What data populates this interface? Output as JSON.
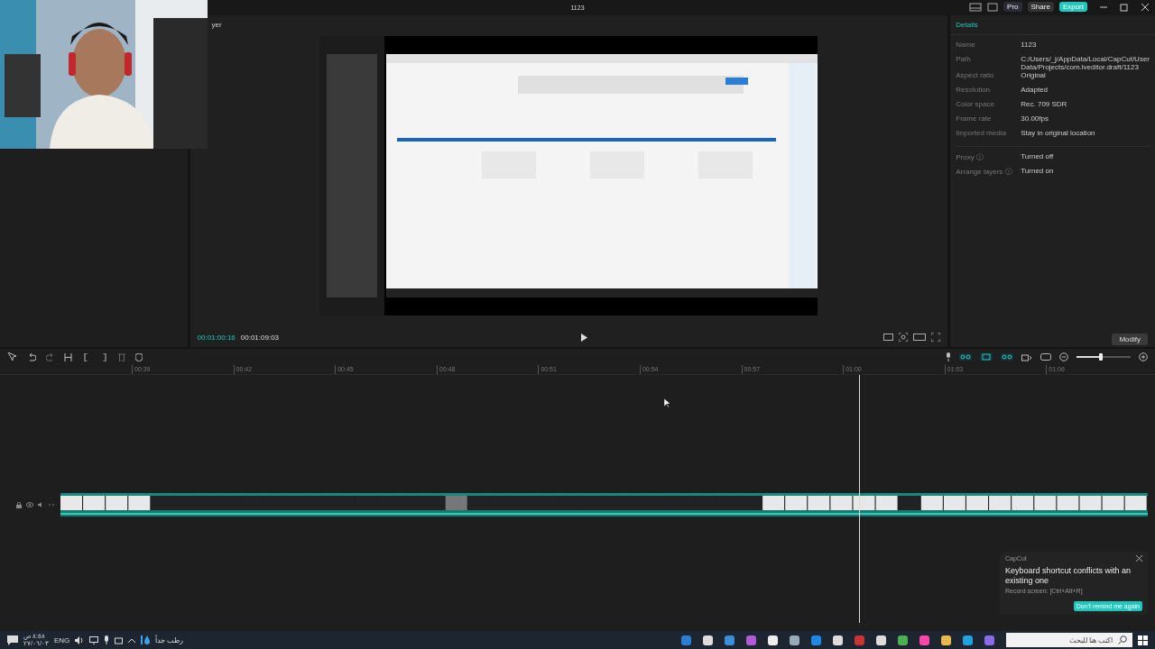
{
  "window": {
    "title": "1123"
  },
  "top_buttons": [
    {
      "label": "Pro",
      "kind": "pro"
    },
    {
      "label": "Share",
      "kind": "share"
    },
    {
      "label": "Export",
      "kind": "export"
    }
  ],
  "player": {
    "title": "yer",
    "current_time": "00:01:00:16",
    "total_time": "00:01:09:03"
  },
  "details": {
    "heading": "Details",
    "rows": [
      {
        "label": "Name",
        "value": "1123"
      },
      {
        "label": "Path",
        "value": "C:/Users/_j/AppData/Local/CapCut/User Data/Projects/com.lveditor.draft/1123"
      },
      {
        "label": "Aspect ratio",
        "value": "Original"
      },
      {
        "label": "Resolution",
        "value": "Adapted"
      },
      {
        "label": "Color space",
        "value": "Rec. 709 SDR"
      },
      {
        "label": "Frame rate",
        "value": "30.00fps"
      },
      {
        "label": "Imported media",
        "value": "Stay in original location"
      },
      {
        "label": "Proxy ⓘ",
        "value": "Turned off"
      },
      {
        "label": "Arrange layers ⓘ",
        "value": "Turned on"
      }
    ],
    "button": "Modify"
  },
  "timeline": {
    "ruler": [
      "00:39",
      "00:42",
      "00:45",
      "00:48",
      "00:51",
      "00:54",
      "00:57",
      "01:00",
      "01:03",
      "01:06"
    ],
    "zoom": {
      "level": 0.45
    }
  },
  "notification": {
    "app": "CapCut",
    "title": "Keyboard shortcut conflicts with an existing one",
    "detail": "Record screen: [Ctrl+Alt+R]",
    "button": "Don't remind me again"
  },
  "taskbar": {
    "time": "٨:٥٨ ص",
    "date": "٢٧/٠٦/٠٣",
    "language": "ENG",
    "weather": "رطب جداً",
    "search_placeholder": "اكتب هنا للبحث"
  }
}
